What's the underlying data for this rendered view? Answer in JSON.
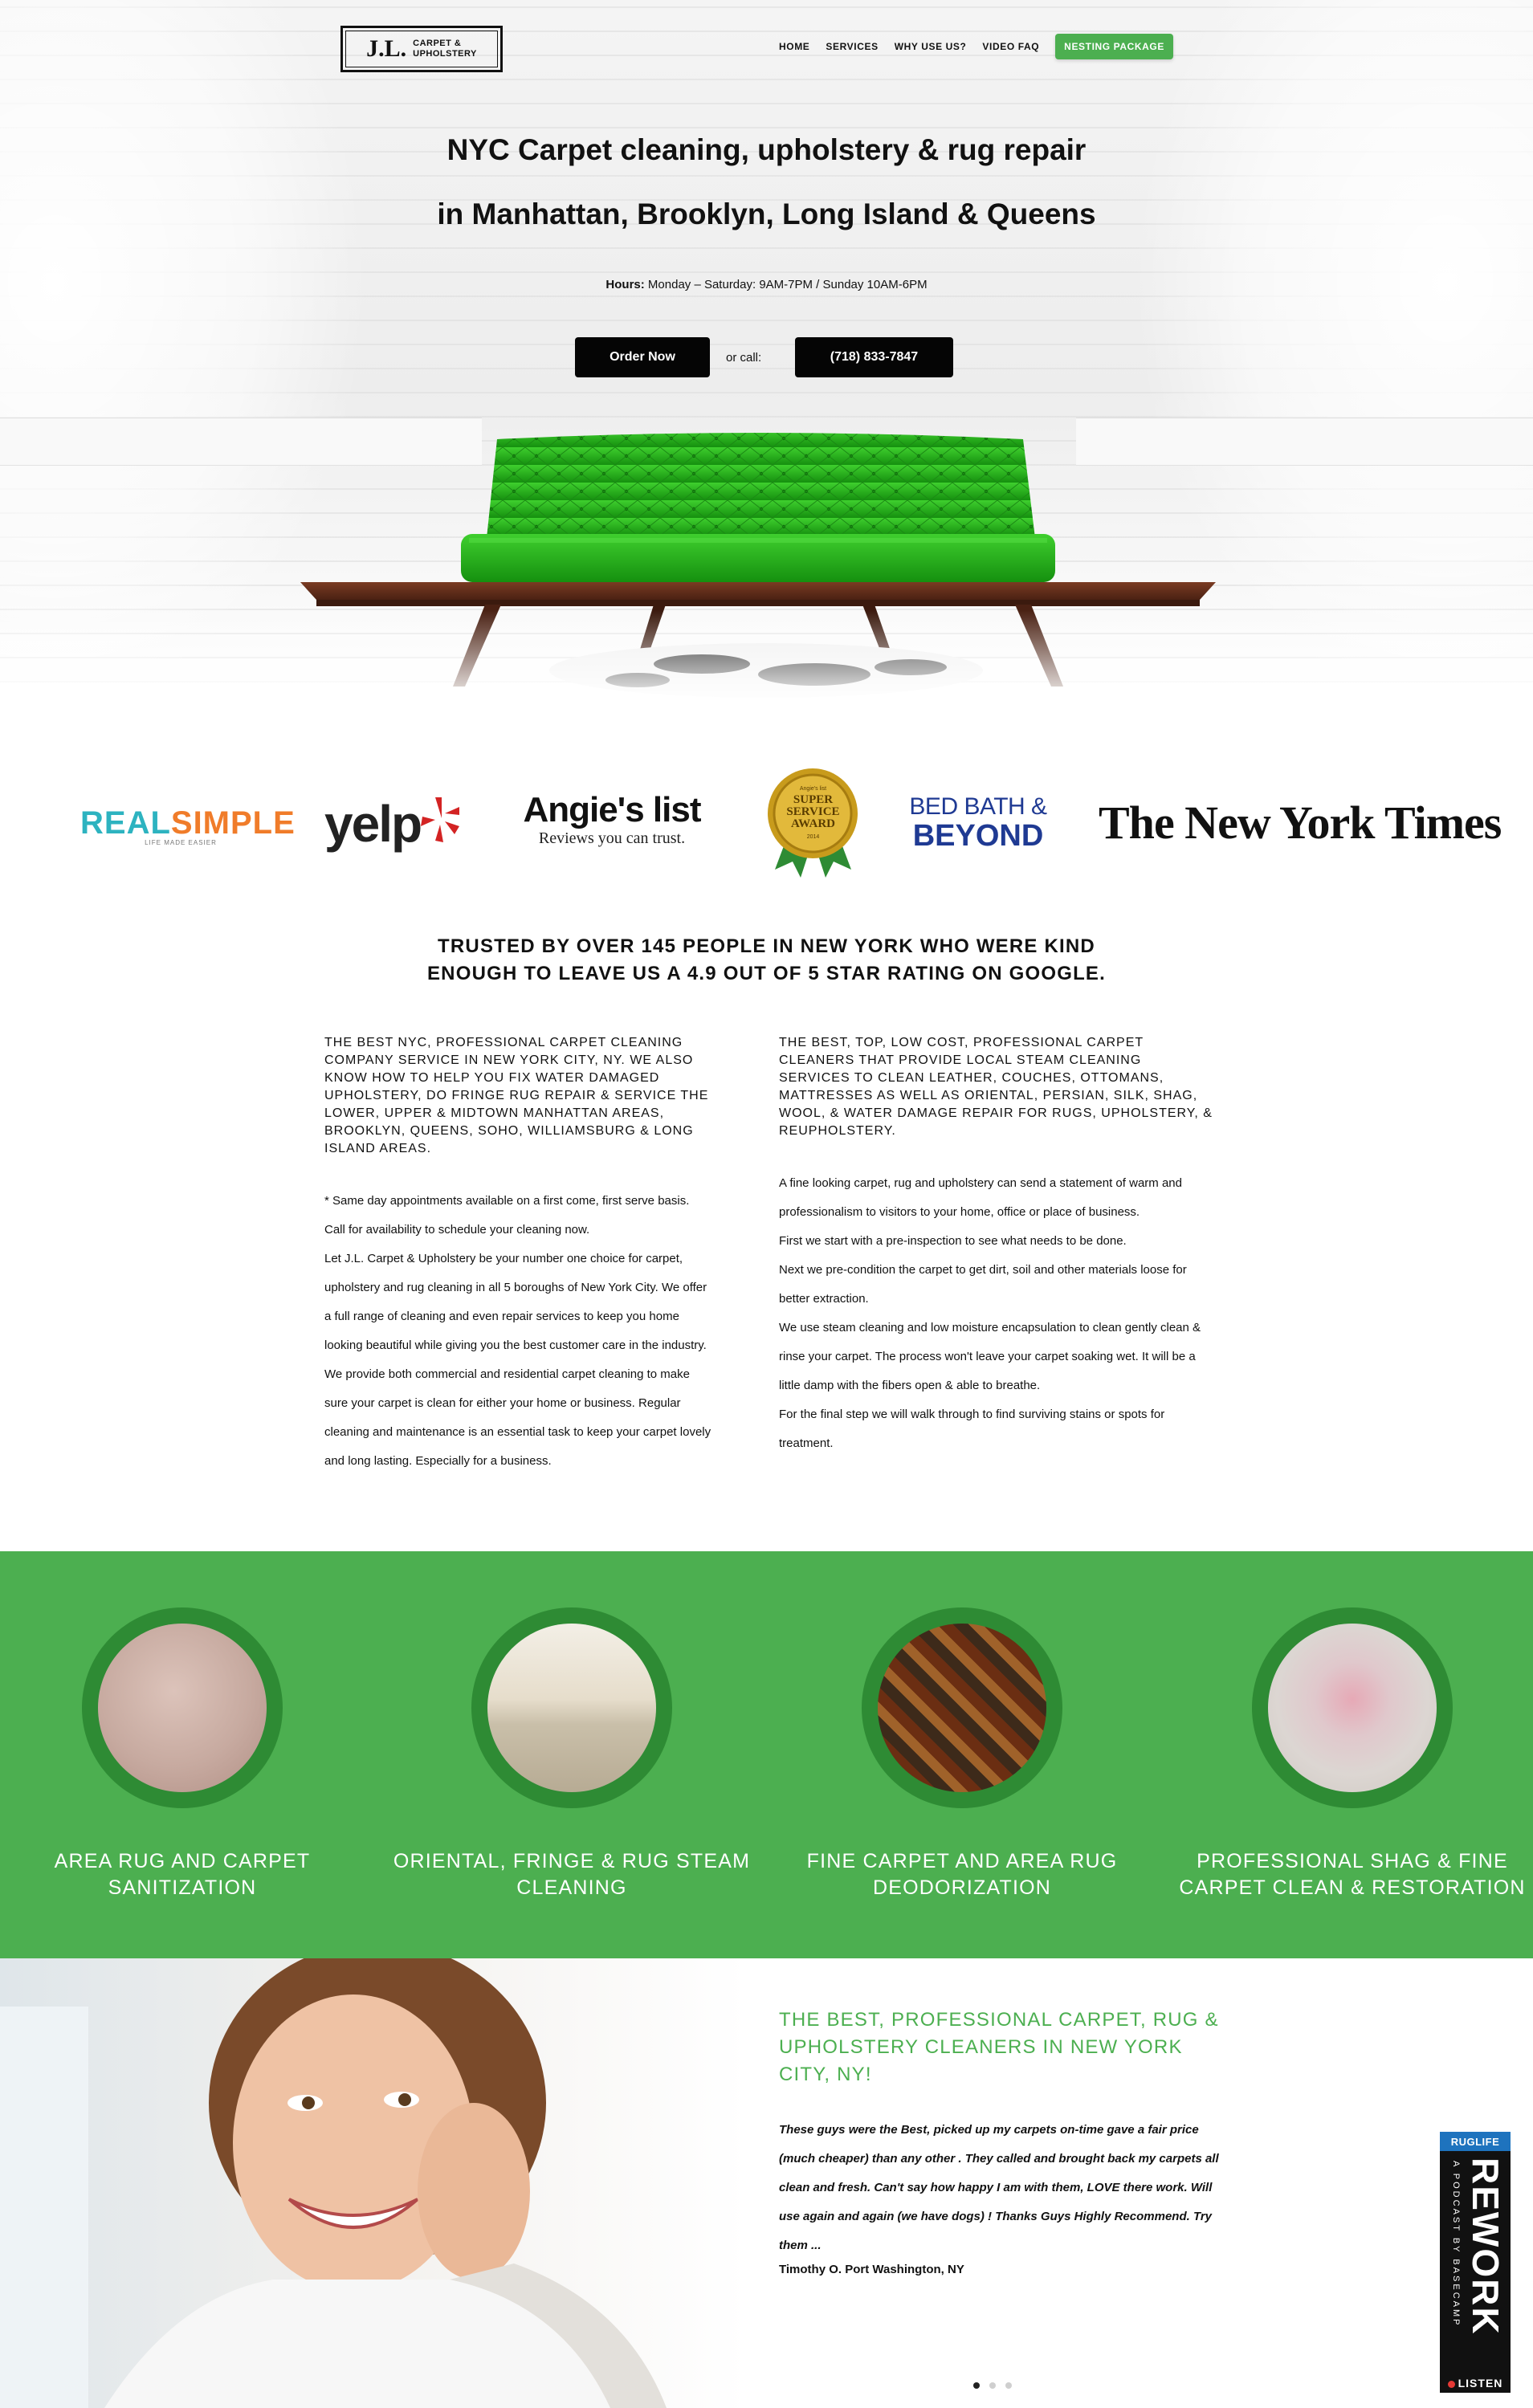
{
  "header": {
    "logo_mark": "J.L.",
    "logo_line1": "CARPET &",
    "logo_line2": "UPHOLSTERY",
    "nav": [
      "HOME",
      "SERVICES",
      "WHY USE US?",
      "VIDEO FAQ"
    ],
    "nav_cta": "NESTING PACKAGE"
  },
  "hero": {
    "title_line1": "NYC Carpet cleaning, upholstery & rug repair",
    "title_line2": "in Manhattan, Brooklyn, Long Island & Queens",
    "hours_label": "Hours:",
    "hours_text": " Monday – Saturday: 9AM-7PM / Sunday 10AM-6PM",
    "order_button": "Order Now",
    "or_call": "or call:",
    "phone_button": "(718) 833-7847"
  },
  "press": {
    "real_simple_1": "REAL",
    "real_simple_2": "SIMPLE",
    "real_simple_tag": "LIFE MADE EASIER",
    "yelp": "yelp",
    "angies": "Angie's list",
    "angies_tag": "Reviews you can trust.",
    "award_top": "Angie's list",
    "award_1": "SUPER",
    "award_2": "SERVICE",
    "award_3": "AWARD",
    "award_year": "2014",
    "bbb_1": "BED BATH &",
    "bbb_2": "BEYOND",
    "nyt": "The New York Times"
  },
  "trusted": {
    "line1": "TRUSTED BY OVER 145 PEOPLE IN NEW YORK WHO WERE KIND",
    "line2": "ENOUGH TO LEAVE US A 4.9 OUT OF 5 STAR RATING ON GOOGLE."
  },
  "left_col": {
    "heading": "THE BEST NYC, PROFESSIONAL CARPET CLEANING COMPANY SERVICE IN NEW YORK CITY, NY. WE ALSO KNOW HOW TO HELP YOU FIX WATER DAMAGED UPHOLSTERY, DO FRINGE RUG REPAIR & SERVICE THE LOWER, UPPER & MIDTOWN MANHATTAN AREAS, BROOKLYN, QUEENS, SOHO, WILLIAMSBURG & LONG ISLAND AREAS.",
    "p1": "* Same day appointments available on a first come, first serve basis.",
    "p2": "Call for availability to schedule your cleaning now.",
    "p3": "Let J.L. Carpet & Upholstery be your number one choice for carpet, upholstery and rug cleaning in all 5 boroughs of New York City. We offer a full range of cleaning and even repair services to keep you home looking beautiful while giving you the best customer care in the industry.",
    "p4": "We provide both commercial and residential carpet cleaning to make sure your carpet is clean for either your home or business. Regular cleaning and maintenance is an essential task to keep your carpet lovely and long lasting. Especially for a business."
  },
  "right_col": {
    "heading": "THE BEST, TOP, LOW COST, PROFESSIONAL CARPET CLEANERS THAT PROVIDE LOCAL STEAM CLEANING SERVICES TO CLEAN LEATHER, COUCHES, OTTOMANS, MATTRESSES AS WELL AS ORIENTAL, PERSIAN, SILK, SHAG, WOOL, & WATER DAMAGE REPAIR FOR RUGS, UPHOLSTERY, & REUPHOLSTERY.",
    "p1": "A fine looking carpet, rug and upholstery can send a statement of warm and professionalism to visitors to your home, office or place of business.",
    "p2": "First we start with a pre-inspection to see what needs to be done.",
    "p3": "Next we pre-condition the carpet to get dirt, soil and other materials loose for better extraction.",
    "p4": "We use steam cleaning and low moisture encapsulation to clean gently clean & rinse your carpet. The process won't leave your carpet soaking wet. It will be a little damp with the fibers open & able to breathe.",
    "p5": "For the final step we will walk through to find surviving stains or spots for treatment."
  },
  "services": [
    {
      "line1": "AREA RUG AND CARPET",
      "line2": "SANITIZATION"
    },
    {
      "line1": "ORIENTAL, FRINGE & RUG STEAM",
      "line2": "CLEANING"
    },
    {
      "line1": "FINE CARPET AND AREA RUG",
      "line2": "DEODORIZATION"
    },
    {
      "line1": "PROFESSIONAL SHAG & FINE",
      "line2": "CARPET CLEAN & RESTORATION"
    }
  ],
  "testimonial": {
    "heading": "THE BEST, PROFESSIONAL CARPET, RUG & UPHOLSTERY CLEANERS IN NEW YORK CITY, NY!",
    "quote": "These guys were the Best, picked up my carpets on-time gave a fair price (much cheaper) than any other . They called and brought back my carpets all clean and fresh. Can't say how happy I am with them, LOVE there work. Will use again and again (we have dogs) ! Thanks Guys Highly Recommend. Try them ...",
    "author": "Timothy O. Port Washington, NY"
  },
  "podcast": {
    "badge": "RUGLIFE",
    "title": "REWORK",
    "subtitle": "A PODCAST BY BASECAMP",
    "listen": "LISTEN"
  },
  "colors": {
    "accent_green": "#4caf50",
    "ring_green": "#2e8b34",
    "button_black": "#050505",
    "podcast_blue": "#1e73be"
  },
  "carousel": {
    "slides": 3,
    "active": 1
  }
}
